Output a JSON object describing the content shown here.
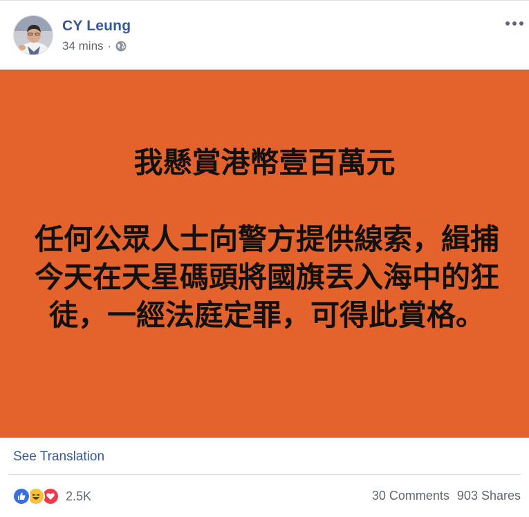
{
  "post": {
    "author": "CY Leung",
    "time": "34 mins",
    "separator": "·",
    "privacy_icon": "globe-icon",
    "more_icon": "more-options-icon"
  },
  "banner": {
    "background_color": "#e4622b",
    "title": "我懸賞港幣壹百萬元",
    "body": "任何公眾人士向警方提供線索，緝捕今天在天星碼頭將國旗丟入海中的狂徒，一經法庭定罪，可得此賞格。"
  },
  "translation": {
    "label": "See Translation"
  },
  "engagement": {
    "reaction_icons": [
      "like-icon",
      "haha-icon",
      "love-icon"
    ],
    "reaction_count": "2.5K",
    "comments": "30 Comments",
    "shares": "903 Shares"
  },
  "colors": {
    "link": "#385898",
    "author": "#365899",
    "meta": "#616770"
  }
}
